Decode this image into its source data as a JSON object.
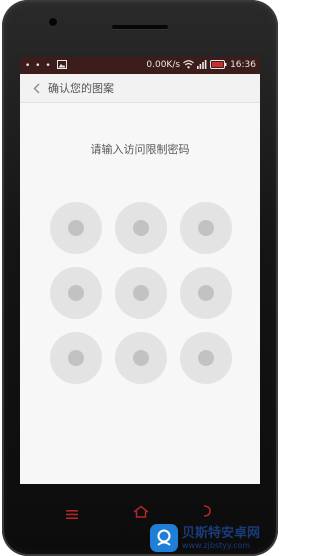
{
  "statusbar": {
    "left_dots": "• • •",
    "net_speed": "0.00K/s",
    "time": "16:36"
  },
  "header": {
    "title": "确认您的图案"
  },
  "main": {
    "prompt": "请输入访问限制密码",
    "pattern_dots": [
      "dot-1",
      "dot-2",
      "dot-3",
      "dot-4",
      "dot-5",
      "dot-6",
      "dot-7",
      "dot-8",
      "dot-9"
    ]
  },
  "navbar": {
    "menu_icon": "menu-icon",
    "home_icon": "home-icon",
    "back_icon": "back-icon"
  },
  "watermark": {
    "title": "贝斯特安卓网",
    "url": "www.zjbstyy.com"
  },
  "colors": {
    "statusbar_bg": "#3d1d1b",
    "screen_bg": "#f7f7f7",
    "dot_outer": "#e3e3e3",
    "dot_core": "#c2c2c2",
    "navkey_red": "#b3262a"
  }
}
